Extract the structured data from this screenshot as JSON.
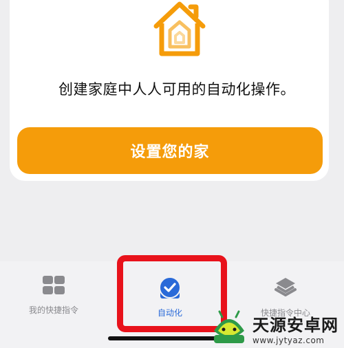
{
  "card": {
    "subtitle": "创建家庭中人人可用的自动化操作。",
    "setup_button_label": "设置您的家",
    "icon": "home-icon"
  },
  "tabbar": {
    "tabs": [
      {
        "label": "我的快捷指令",
        "icon": "grid-icon",
        "active": false
      },
      {
        "label": "自动化",
        "icon": "clock-check-icon",
        "active": true
      },
      {
        "label": "快捷指令中心",
        "icon": "layers-icon",
        "active": false
      }
    ]
  },
  "watermark": {
    "title": "天源安卓网",
    "url": "www.jytyaz.com"
  },
  "colors": {
    "accent_orange": "#f59c0a",
    "active_blue": "#2a6ad8",
    "highlight_red": "#e8121b",
    "inactive_gray": "#8a8a8e"
  }
}
